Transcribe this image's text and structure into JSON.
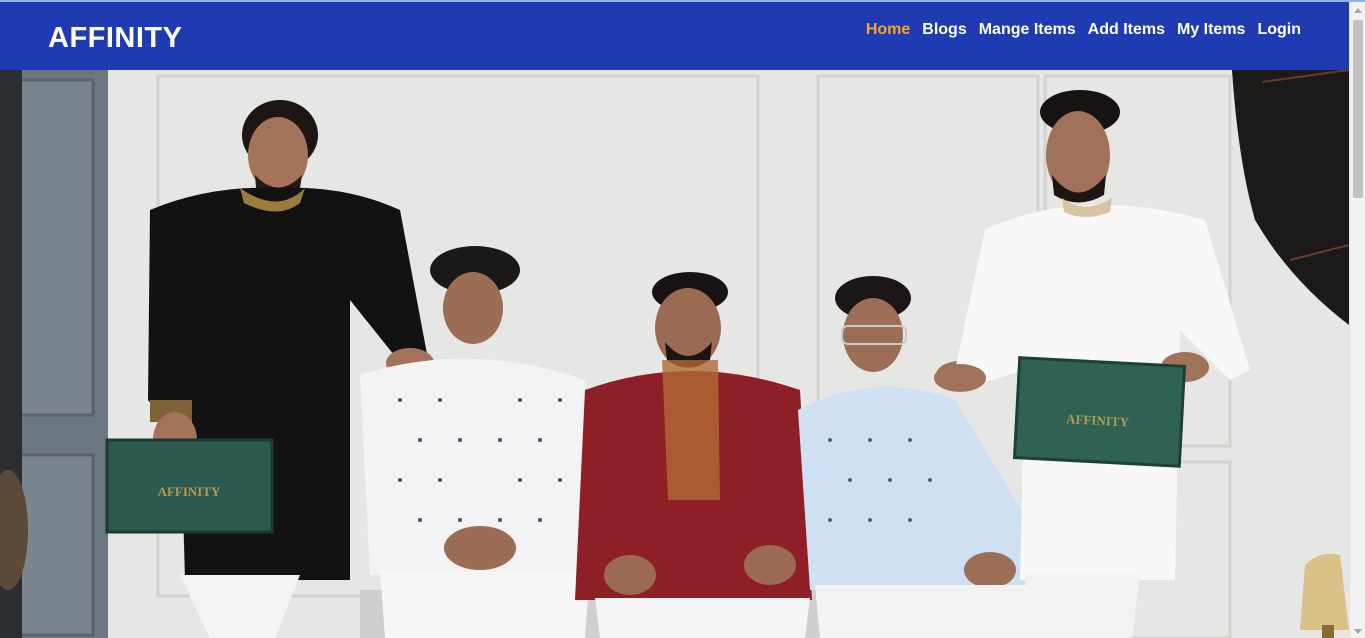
{
  "brand": {
    "name": "AFFINITY"
  },
  "nav": {
    "items": [
      {
        "label": "Home",
        "active": true
      },
      {
        "label": "Blogs",
        "active": false
      },
      {
        "label": "Mange Items",
        "active": false
      },
      {
        "label": "Add Items",
        "active": false
      },
      {
        "label": "My Items",
        "active": false
      },
      {
        "label": "Login",
        "active": false
      }
    ]
  },
  "hero": {
    "box_logo_text": "AFFINITY"
  },
  "colors": {
    "navbar": "#1f3bb1",
    "active_link": "#f6a623",
    "link": "#ffffff"
  }
}
